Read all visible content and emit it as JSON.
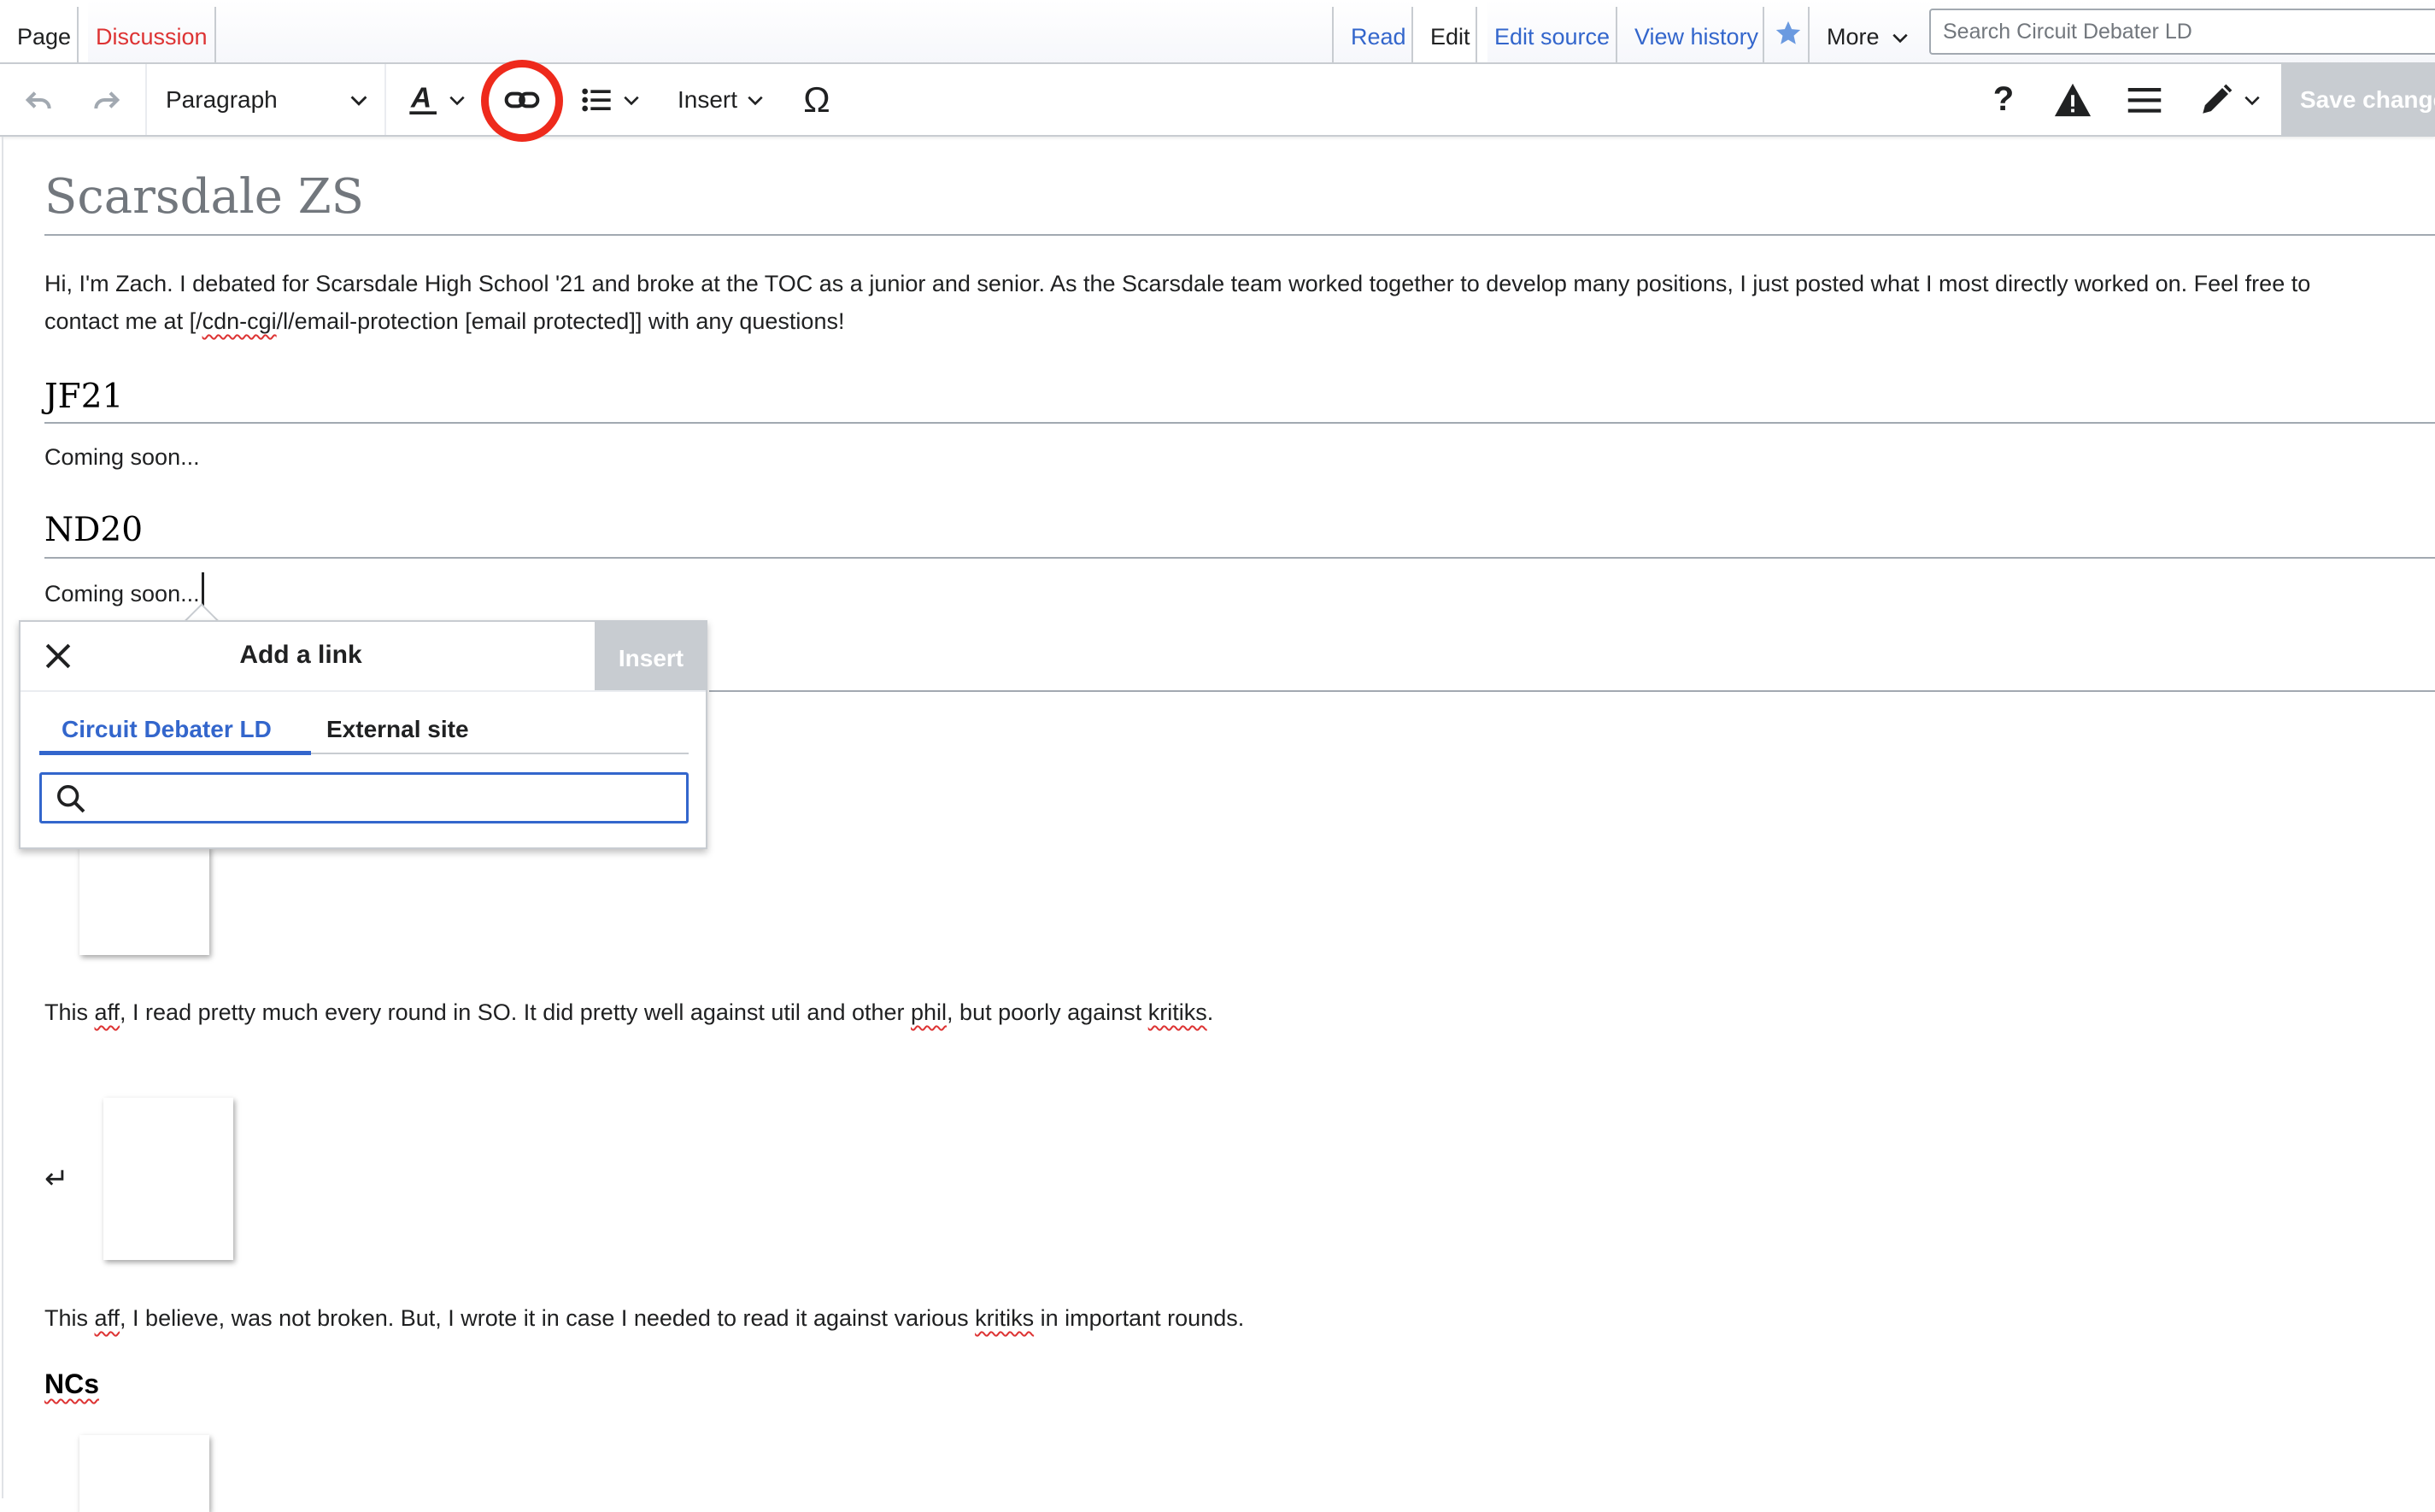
{
  "tabs": {
    "page": "Page",
    "discussion": "Discussion",
    "read": "Read",
    "edit": "Edit",
    "edit_source": "Edit source",
    "view_history": "View history",
    "more": "More"
  },
  "search": {
    "placeholder": "Search Circuit Debater LD"
  },
  "toolbar": {
    "paragraph": "Paragraph",
    "insert": "Insert",
    "special_char": "Ω",
    "help": "?",
    "save": "Save changes"
  },
  "article": {
    "title": "Scarsdale ZS",
    "intro_line1": "Hi, I'm Zach. I debated for Scarsdale High School '21 and broke at the TOC as a junior and senior. As the Scarsdale team worked together to develop many positions, I just posted what I most directly worked on. Feel free to",
    "intro_line2_before": "contact me at [/",
    "intro_line2_spell": "cdn-cgi",
    "intro_line2_after": "/l/email-protection [email protected]] with any questions!",
    "h_jf21": "JF21",
    "coming_soon_1": "Coming soon...",
    "h_nd20": "ND20",
    "coming_soon_2": "Coming soon...",
    "aff1_a": "This ",
    "aff1_b": "aff",
    "aff1_c": ", I read pretty much every round in SO. It did pretty well against util and other ",
    "aff1_d": "phil",
    "aff1_e": ", but poorly against ",
    "aff1_f": "kritiks",
    "aff1_g": ".",
    "pilcrow": "↵",
    "aff2_a": "This ",
    "aff2_b": "aff",
    "aff2_c": ", I believe, was not broken. But, I wrote it in case I needed to read it against various ",
    "aff2_d": "kritiks",
    "aff2_e": " in important rounds.",
    "h_ncs": "NCs"
  },
  "link_popup": {
    "title": "Add a link",
    "insert": "Insert",
    "tab_internal": "Circuit Debater LD",
    "tab_external": "External site",
    "search_value": ""
  },
  "colors": {
    "link": "#3366cc",
    "red_link": "#dd3333",
    "highlight": "#ee2a1c",
    "disabled": "#c8ccd1"
  }
}
